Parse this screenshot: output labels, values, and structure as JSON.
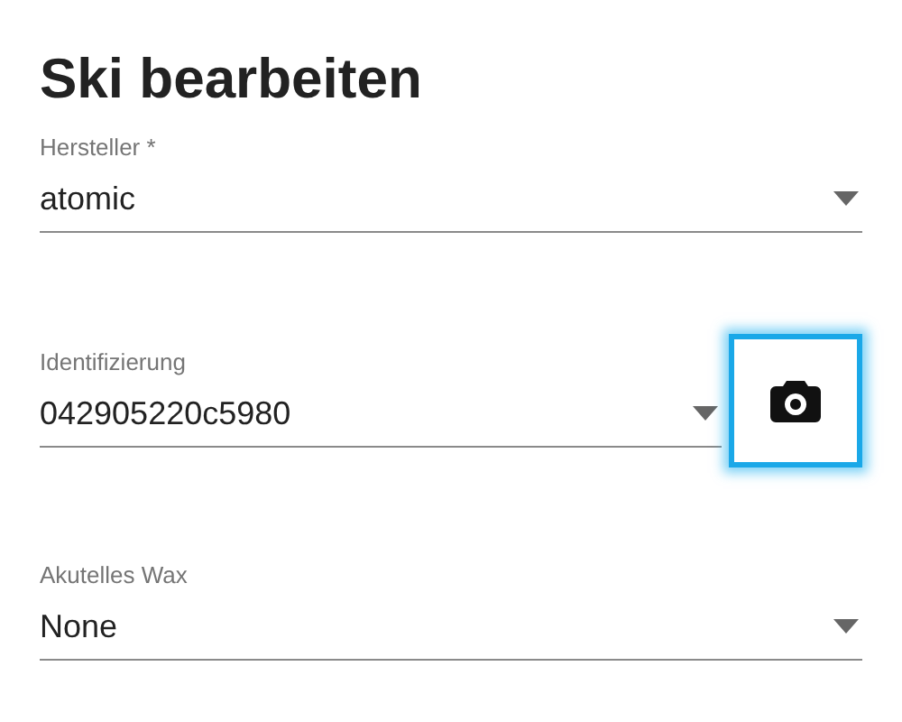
{
  "title": "Ski bearbeiten",
  "fields": [
    {
      "label": "Hersteller *",
      "value": "atomic",
      "camera": false
    },
    {
      "label": "Identifizierung",
      "value": "042905220c5980",
      "camera": true
    },
    {
      "label": "Akutelles Wax",
      "value": "None",
      "camera": false
    }
  ],
  "camera_button": {
    "focused": true
  }
}
